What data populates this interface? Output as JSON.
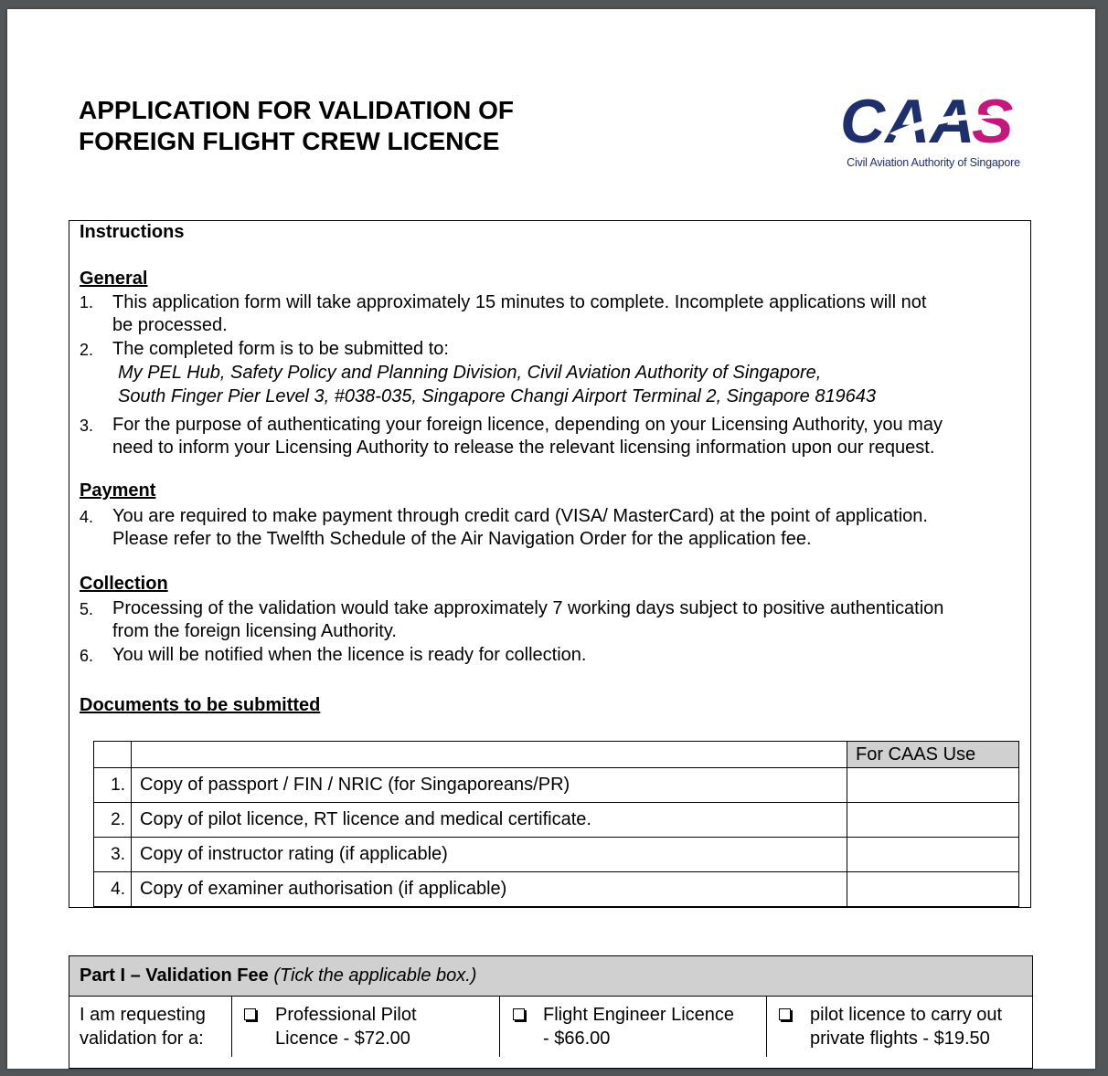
{
  "title": {
    "line1": "APPLICATION FOR VALIDATION OF",
    "line2": "FOREIGN FLIGHT CREW LICENCE"
  },
  "logo": {
    "text": "CAAS",
    "tagline": "Civil Aviation Authority of Singapore",
    "colors": {
      "navy": "#1e2f6e",
      "magenta": "#c8177c"
    }
  },
  "instructions": {
    "heading": "Instructions",
    "general": {
      "heading": "General",
      "item1": {
        "num": "1.",
        "line1": "This application form will take approximately 15 minutes to complete. Incomplete applications will not",
        "line2": "be processed."
      },
      "item2": {
        "num": "2.",
        "line1": "The completed form is to be submitted to:"
      },
      "address_line1": "My PEL Hub, Safety Policy and Planning Division, Civil Aviation Authority of Singapore,",
      "address_line2": "South Finger Pier Level 3, #038-035, Singapore Changi Airport Terminal 2, Singapore 819643",
      "item3": {
        "num": "3.",
        "line1": "For the purpose of authenticating your foreign licence, depending on your Licensing Authority, you may",
        "line2": "need to inform your Licensing Authority to release the relevant licensing information upon our request."
      }
    },
    "payment": {
      "heading": "Payment",
      "item4": {
        "num": "4.",
        "line1": "You are required to make payment through credit card (VISA/ MasterCard) at the point of application.",
        "line2": "Please refer to the Twelfth Schedule of the Air Navigation Order for the application fee."
      }
    },
    "collection": {
      "heading": "Collection",
      "item5": {
        "num": "5.",
        "line1": "Processing of the validation would take approximately 7 working days subject to positive authentication",
        "line2": "from the foreign licensing Authority."
      },
      "item6": {
        "num": "6.",
        "line1": "You will be notified when the licence is ready for collection."
      }
    },
    "documents": {
      "heading": "Documents to be submitted",
      "caas_use_header": "For CAAS Use",
      "rows": [
        {
          "num": "1.",
          "text": "Copy of passport / FIN / NRIC (for Singaporeans/PR)"
        },
        {
          "num": "2.",
          "text": "Copy of pilot licence, RT licence and medical certificate."
        },
        {
          "num": "3.",
          "text": "Copy of instructor rating (if applicable)"
        },
        {
          "num": "4.",
          "text": "Copy of examiner authorisation (if applicable)"
        }
      ]
    }
  },
  "part1": {
    "title_bold": "Part I – Validation Fee",
    "title_italic": "(Tick the applicable box.)",
    "request_label_line1": "I am requesting",
    "request_label_line2": "validation for a:",
    "options": [
      {
        "line1": "Professional Pilot",
        "line2": "Licence - $72.00"
      },
      {
        "line1": "Flight Engineer Licence",
        "line2": "- $66.00"
      },
      {
        "line1": "pilot licence to carry out",
        "line2": "private flights - $19.50"
      }
    ]
  }
}
